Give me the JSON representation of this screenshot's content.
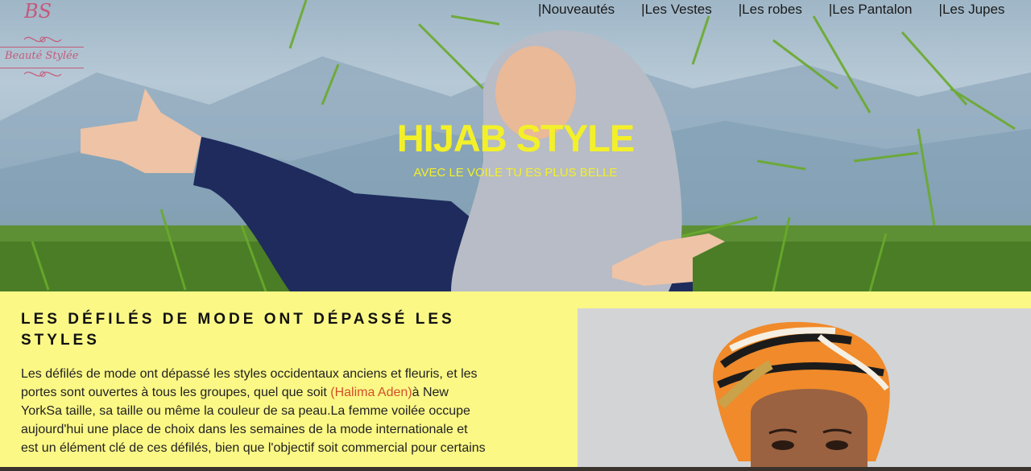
{
  "logo": {
    "monogram": "BS",
    "name": "Beauté Stylée"
  },
  "nav": {
    "separator": "| ",
    "items": [
      "Nouveautés",
      "Les Vestes",
      "Les robes",
      "Les Pantalon",
      "Les Jupes"
    ]
  },
  "hero": {
    "title": "HIJAB STYLE",
    "subtitle": "AVEC LE VOILE TU ES PLUS BELLE"
  },
  "section": {
    "heading": "LES DÉFILÉS DE MODE ONT DÉPASSÉ LES STYLES",
    "paragraph": {
      "before": "Les défilés de mode ont dépassé les styles occidentaux anciens et fleuris, et les portes sont ouvertes à tous les groupes, quel que soit ",
      "highlight": "(Halima Aden)",
      "after": "à New YorkSa taille, sa taille ou même la couleur de sa peau.La femme voilée occupe aujourd'hui une place de choix dans les semaines de la mode internationale et est un élément clé de ces défilés, bien que l'objectif soit commercial pour certains"
    }
  },
  "colors": {
    "page_bg": "#fbf886",
    "title_yellow": "#f3f02a",
    "highlight": "#d2502a",
    "logo_pink": "#c45a7a"
  }
}
